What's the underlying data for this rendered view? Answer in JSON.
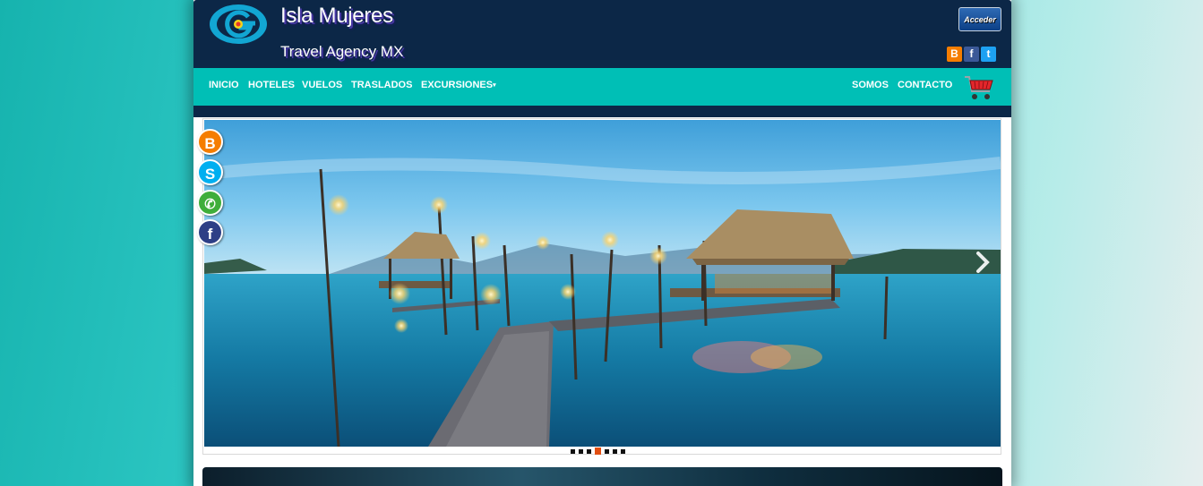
{
  "header": {
    "site_title": "Isla Mujeres",
    "site_subtitle": "Travel Agency MX",
    "login_label": "Acceder",
    "social_top": [
      {
        "icon": "blogger-icon",
        "glyph": "B",
        "color": "#f57d00"
      },
      {
        "icon": "facebook-icon",
        "glyph": "f",
        "color": "#3b5998"
      },
      {
        "icon": "twitter-icon",
        "glyph": "t",
        "color": "#1da1f2"
      }
    ]
  },
  "nav": {
    "left_items": [
      "INICIO",
      "HOTELES",
      "VUELOS",
      "TRASLADOS",
      "EXCURSIONES"
    ],
    "right_items": [
      "SOMOS",
      "CONTACTO"
    ],
    "cart_icon": "shopping-cart-icon"
  },
  "slider": {
    "slide_count": 7,
    "active_index": 3,
    "next_icon": "chevron-right-icon"
  },
  "side_social": [
    {
      "icon": "blogger-icon",
      "glyph": "B",
      "color": "#f57d00"
    },
    {
      "icon": "skype-icon",
      "glyph": "S",
      "color": "#00aff0"
    },
    {
      "icon": "whatsapp-icon",
      "glyph": "✆",
      "color": "#3fae3b"
    },
    {
      "icon": "facebook-icon",
      "glyph": "f",
      "color": "#3b5998"
    }
  ],
  "colors": {
    "header_bg": "#0c2747",
    "nav_bg": "#00bfb6",
    "active_dot": "#e14e11"
  }
}
